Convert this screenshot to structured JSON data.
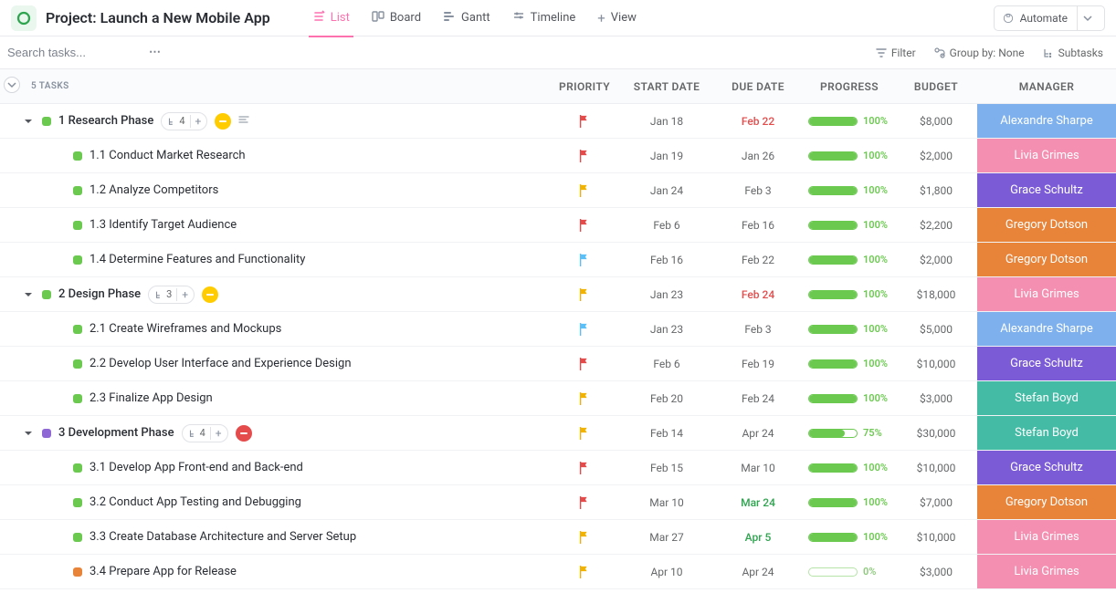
{
  "header": {
    "project_title": "Project: Launch a New Mobile App",
    "automate_label": "Automate"
  },
  "views": [
    {
      "label": "List",
      "active": true
    },
    {
      "label": "Board",
      "active": false
    },
    {
      "label": "Gantt",
      "active": false
    },
    {
      "label": "Timeline",
      "active": false
    },
    {
      "label": "View",
      "add": true
    }
  ],
  "search": {
    "placeholder": "Search tasks..."
  },
  "filters": {
    "filter_label": "Filter",
    "groupby_label": "Group by: None",
    "subtasks_label": "Subtasks"
  },
  "columns": {
    "tasks_count": "5 TASKS",
    "priority": "PRIORITY",
    "start_date": "START DATE",
    "due_date": "DUE DATE",
    "progress": "PROGRESS",
    "budget": "BUDGET",
    "manager": "MANAGER"
  },
  "manager_colors": {
    "Alexandre Sharpe": "#7db0ec",
    "Livia Grimes": "#f48fb1",
    "Grace Schultz": "#7b5bd6",
    "Gregory Dotson": "#e8833a",
    "Stefan Boyd": "#44bba4"
  },
  "rows": [
    {
      "type": "parent",
      "status": "#6bc950",
      "name": "1 Research Phase",
      "subcount": "4",
      "state": "yellow",
      "desc": true,
      "flag": "#e54b4b",
      "start": "Jan 18",
      "due": "Feb 22",
      "due_style": "red",
      "progress": 100,
      "budget": "$8,000",
      "manager": "Alexandre Sharpe"
    },
    {
      "type": "child",
      "status": "#6bc950",
      "name": "1.1 Conduct Market Research",
      "flag": "#e54b4b",
      "start": "Jan 19",
      "due": "Jan 26",
      "progress": 100,
      "budget": "$2,000",
      "manager": "Livia Grimes"
    },
    {
      "type": "child",
      "status": "#6bc950",
      "name": "1.2 Analyze Competitors",
      "flag": "#f2b200",
      "start": "Jan 24",
      "due": "Feb 3",
      "progress": 100,
      "budget": "$1,800",
      "manager": "Grace Schultz"
    },
    {
      "type": "child",
      "status": "#6bc950",
      "name": "1.3 Identify Target Audience",
      "flag": "#e54b4b",
      "start": "Feb 6",
      "due": "Feb 16",
      "progress": 100,
      "budget": "$2,200",
      "manager": "Gregory Dotson"
    },
    {
      "type": "child",
      "status": "#6bc950",
      "name": "1.4 Determine Features and Functionality",
      "flag": "#5bc0f8",
      "start": "Feb 16",
      "due": "Feb 22",
      "progress": 100,
      "budget": "$2,000",
      "manager": "Gregory Dotson"
    },
    {
      "type": "parent",
      "status": "#6bc950",
      "name": "2 Design Phase",
      "subcount": "3",
      "state": "yellow",
      "flag": "#f2b200",
      "start": "Jan 23",
      "due": "Feb 24",
      "due_style": "red",
      "progress": 100,
      "budget": "$18,000",
      "manager": "Livia Grimes"
    },
    {
      "type": "child",
      "status": "#6bc950",
      "name": "2.1 Create Wireframes and Mockups",
      "flag": "#5bc0f8",
      "start": "Jan 23",
      "due": "Feb 3",
      "progress": 100,
      "budget": "$5,000",
      "manager": "Alexandre Sharpe"
    },
    {
      "type": "child",
      "status": "#6bc950",
      "name": "2.2 Develop User Interface and Experience Design",
      "flag": "#e54b4b",
      "start": "Feb 6",
      "due": "Feb 19",
      "progress": 100,
      "budget": "$10,000",
      "manager": "Grace Schultz"
    },
    {
      "type": "child",
      "status": "#6bc950",
      "name": "2.3 Finalize App Design",
      "flag": "#f2b200",
      "start": "Feb 20",
      "due": "Feb 24",
      "progress": 100,
      "budget": "$3,000",
      "manager": "Stefan Boyd"
    },
    {
      "type": "parent",
      "status": "#8f68d6",
      "name": "3 Development Phase",
      "subcount": "4",
      "state": "red",
      "flag": "#f2b200",
      "start": "Feb 14",
      "due": "Apr 24",
      "progress": 75,
      "budget": "$30,000",
      "manager": "Stefan Boyd"
    },
    {
      "type": "child",
      "status": "#6bc950",
      "name": "3.1 Develop App Front-end and Back-end",
      "flag": "#e54b4b",
      "start": "Feb 15",
      "due": "Mar 10",
      "progress": 100,
      "budget": "$10,000",
      "manager": "Grace Schultz"
    },
    {
      "type": "child",
      "status": "#6bc950",
      "name": "3.2 Conduct App Testing and Debugging",
      "flag": "#e54b4b",
      "start": "Mar 10",
      "due": "Mar 24",
      "due_style": "green",
      "progress": 100,
      "budget": "$7,000",
      "manager": "Gregory Dotson"
    },
    {
      "type": "child",
      "status": "#6bc950",
      "name": "3.3 Create Database Architecture and Server Setup",
      "flag": "#f2b200",
      "start": "Mar 27",
      "due": "Apr 5",
      "due_style": "green",
      "progress": 100,
      "budget": "$10,000",
      "manager": "Livia Grimes"
    },
    {
      "type": "child",
      "status": "#e8833a",
      "name": "3.4 Prepare App for Release",
      "flag": "#f2b200",
      "start": "Apr 10",
      "due": "Apr 24",
      "progress": 0,
      "budget": "$3,000",
      "manager": "Livia Grimes"
    }
  ]
}
